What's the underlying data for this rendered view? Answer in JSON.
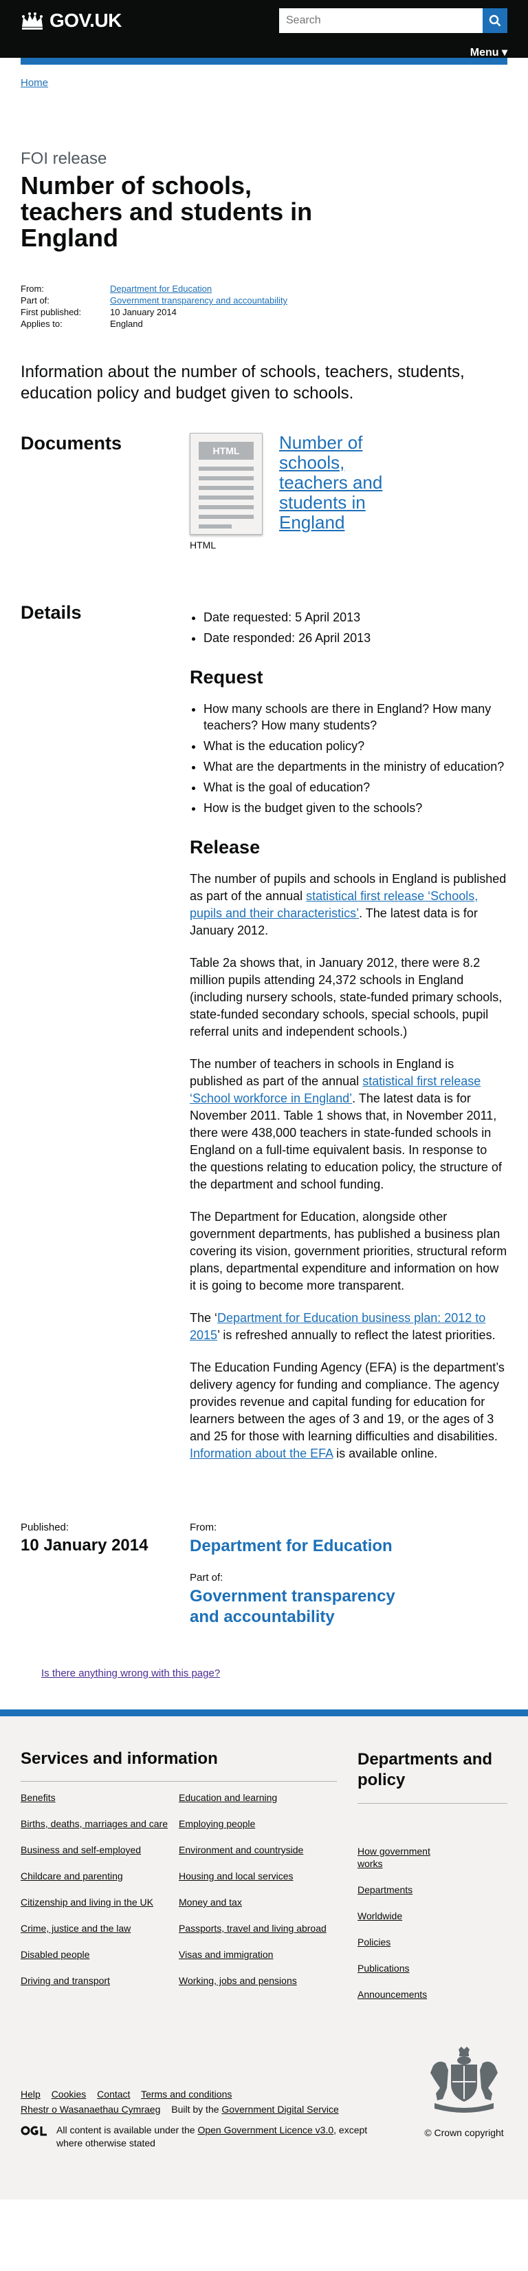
{
  "header": {
    "logo_text": "GOV.UK",
    "search_placeholder": "Search",
    "menu_label": "Menu ▾"
  },
  "breadcrumb": {
    "home": "Home"
  },
  "page": {
    "doc_type": "FOI release",
    "title": "Number of schools, teachers and students in England",
    "meta": [
      {
        "key": "From:",
        "value": "Department for Education",
        "link": true
      },
      {
        "key": "Part of:",
        "value": "Government transparency and accountability",
        "link": true
      },
      {
        "key": "First published:",
        "value": "10 January 2014",
        "link": false
      },
      {
        "key": "Applies to:",
        "value": "England",
        "link": false
      }
    ],
    "description": "Information about the number of schools, teachers, students, education policy and budget given to schools."
  },
  "documents": {
    "heading": "Documents",
    "thumb_tag": "HTML",
    "title": "Number of schools, teachers and students in England",
    "type": "HTML"
  },
  "details": {
    "heading": "Details",
    "dates": [
      "Date requested: 5 April 2013",
      "Date responded: 26 April 2013"
    ],
    "request_heading": "Request",
    "request_items": [
      "How many schools are there in England? How many teachers? How many students?",
      "What is the education policy?",
      "What are the departments in the ministry of education?",
      "What is the goal of education?",
      "How is the budget given to the schools?"
    ],
    "release_heading": "Release",
    "p1_a": "The number of pupils and schools in England is published as part of the annual ",
    "p1_link": "statistical first release ‘Schools, pupils and their characteristics’",
    "p1_b": ". The latest data is for January 2012.",
    "p2": "Table 2a shows that, in January 2012, there were 8.2 million pupils attending 24,372 schools in England (including nursery schools, state-funded primary schools, state-funded secondary schools, special schools, pupil referral units and independent schools.)",
    "p3_a": "The number of teachers in schools in England is published as part of the annual ",
    "p3_link": "statistical first release ‘School workforce in England’",
    "p3_b": ". The latest data is for November 2011. Table 1 shows that, in November 2011, there were 438,000 teachers in state-funded schools in England on a full-time equivalent basis. In response to the questions relating to education policy, the structure of the department and school funding.",
    "p4": "The Department for Education, alongside other government departments, has published a business plan covering its vision, government priorities, structural reform plans, departmental expenditure and information on how it is going to become more transparent.",
    "p5_a": "The ‘",
    "p5_link": "Department for Education business plan: 2012 to 2015",
    "p5_b": "’ is refreshed annually to reflect the latest priorities.",
    "p6_a": "The Education Funding Agency (EFA) is the department’s delivery agency for funding and compliance. The agency provides revenue and capital funding for education for learners between the ages of 3 and 19, or the ages of 3 and 25 for those with learning difficulties and disabilities. ",
    "p6_link": "Information about the EFA",
    "p6_b": " is available online."
  },
  "published": {
    "label": "Published:",
    "date": "10 January 2014",
    "from_label": "From:",
    "from_value": "Department for Education",
    "part_label": "Part of:",
    "part_value": "Government transparency and accountability"
  },
  "report_link": "Is there anything wrong with this page?",
  "footer": {
    "services_heading": "Services and information",
    "services_col1": [
      "Benefits",
      "Births, deaths, marriages and care",
      "Business and self-employed",
      "Childcare and parenting",
      "Citizenship and living in the UK",
      "Crime, justice and the law",
      "Disabled people",
      "Driving and transport"
    ],
    "services_col2": [
      "Education and learning",
      "Employing people",
      "Environment and countryside",
      "Housing and local services",
      "Money and tax",
      "Passports, travel and living abroad",
      "Visas and immigration",
      "Working, jobs and pensions"
    ],
    "departments_heading": "Departments and policy",
    "departments": [
      "How government works",
      "Departments",
      "Worldwide",
      "Policies",
      "Publications",
      "Announcements"
    ],
    "support_links": [
      "Help",
      "Cookies",
      "Contact",
      "Terms and conditions"
    ],
    "welsh_link": "Rhestr o Wasanaethau Cymraeg",
    "built_by_text": "Built by the ",
    "built_by_link": "Government Digital Service",
    "licence_a": "All content is available under the ",
    "licence_link": "Open Government Licence v3.0",
    "licence_b": ", except where otherwise stated",
    "copyright": "© Crown copyright"
  }
}
